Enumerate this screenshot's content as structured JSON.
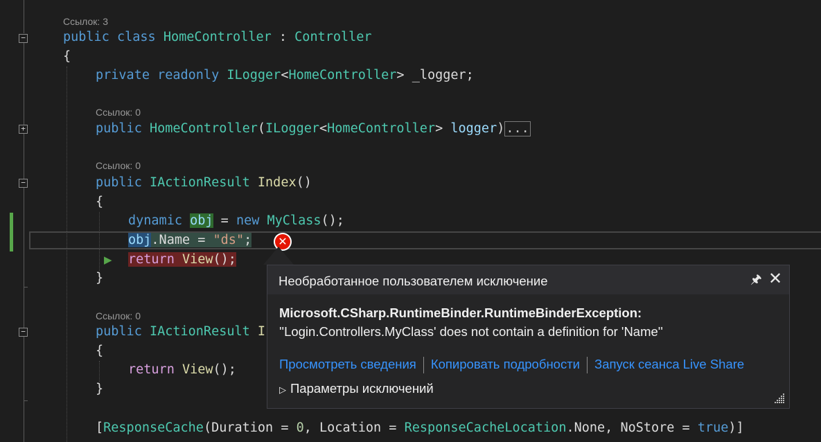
{
  "editor": {
    "codelens": {
      "class_refs": "Ссылок: 3",
      "ctor_refs": "Ссылок: 0",
      "index_refs": "Ссылок: 0",
      "method2_refs": "Ссылок: 0"
    },
    "code": {
      "l_class": {
        "t1": "public",
        "t2": "class",
        "t3": "HomeController",
        "t4": ":",
        "t5": "Controller"
      },
      "l_open": "{",
      "l_field": {
        "t1": "private",
        "t2": "readonly",
        "t3": "ILogger",
        "t4": "<",
        "t5": "HomeController",
        "t6": ">",
        "t7": "_logger;"
      },
      "l_ctor": {
        "t1": "public",
        "t2": "HomeController",
        "t3": "(",
        "t4": "ILogger",
        "t5": "<",
        "t6": "HomeController",
        "t7": ">",
        "t8": "logger",
        "t9": ")",
        "t10": "..."
      },
      "l_index": {
        "t1": "public",
        "t2": "IActionResult",
        "t3": "Index",
        "t4": "()"
      },
      "l_open2": "{",
      "l_dyn": {
        "t1": "dynamic",
        "t2": "obj",
        "t3": "=",
        "t4": "new",
        "t5": "MyClass",
        "t6": "();"
      },
      "l_assign": {
        "t1": "obj",
        "t2": ".Name = ",
        "t3": "\"ds\"",
        "t4": ";"
      },
      "l_return": {
        "t1": "return",
        "t2": "View",
        "t3": "();"
      },
      "l_close2": "}",
      "l_method2": {
        "t1": "public",
        "t2": "IActionResult",
        "t3": "I"
      },
      "l_open3": "{",
      "l_return2": {
        "t1": "return",
        "t2": "View",
        "t3": "();"
      },
      "l_close3": "}",
      "l_attr": {
        "t1": "[",
        "t2": "ResponseCache",
        "t3": "(",
        "t4": "Duration",
        "t5": " = ",
        "t6": "0",
        "t7": ", ",
        "t8": "Location",
        "t9": " = ",
        "t10": "ResponseCacheLocation",
        "t11": ".None, ",
        "t12": "NoStore",
        "t13": " = ",
        "t14": "true",
        "t15": ")]"
      }
    },
    "fold_buttons": {
      "minus": "−",
      "plus": "+"
    },
    "next_statement_glyph": "▶",
    "error_glyph": "✕"
  },
  "exception_popup": {
    "title": "Необработанное пользователем исключение",
    "pin_glyph": "📌",
    "close_glyph": "✕",
    "exception_type": "Microsoft.CSharp.RuntimeBinder.RuntimeBinderException:",
    "message": "''Login.Controllers.MyClass' does not contain a definition for 'Name''",
    "links": [
      "Просмотреть сведения",
      "Копировать подробности",
      "Запуск сеанса Live Share"
    ],
    "params_label": "Параметры исключений",
    "params_glyph": "▷"
  },
  "colors": {
    "background": "#1e1e1e",
    "keyword": "#569cd6",
    "type": "#4ec9b0",
    "method": "#dcdcaa",
    "identifier": "#9cdcfe",
    "string": "#d69d85",
    "link": "#3794ff",
    "error": "#e51400"
  }
}
